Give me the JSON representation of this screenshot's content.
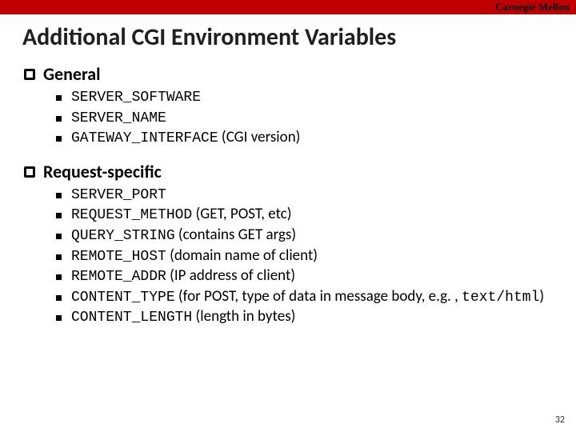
{
  "brand": "Carnegie Mellon",
  "title": "Additional CGI Environment Variables",
  "sections": [
    {
      "heading": "General",
      "items": [
        {
          "code": "SERVER_SOFTWARE",
          "suffix": ""
        },
        {
          "code": "SERVER_NAME",
          "suffix": ""
        },
        {
          "code": "GATEWAY_INTERFACE",
          "suffix": " (CGI version)"
        }
      ]
    },
    {
      "heading": "Request-specific",
      "items": [
        {
          "code": "SERVER_PORT",
          "suffix": ""
        },
        {
          "code": "REQUEST_METHOD",
          "suffix": " (GET, POST, etc)"
        },
        {
          "code": "QUERY_STRING",
          "suffix": " (contains GET args)"
        },
        {
          "code": "REMOTE_HOST",
          "suffix": " (domain name of client)"
        },
        {
          "code": "REMOTE_ADDR",
          "suffix": " (IP address of client)"
        },
        {
          "code": "CONTENT_TYPE",
          "suffix": " (for POST, type of data in message body, e.g. , ",
          "code2": "text/html",
          "suffix2": ")"
        },
        {
          "code": "CONTENT_LENGTH",
          "suffix": " (length in bytes)"
        }
      ]
    }
  ],
  "page_number": "32"
}
